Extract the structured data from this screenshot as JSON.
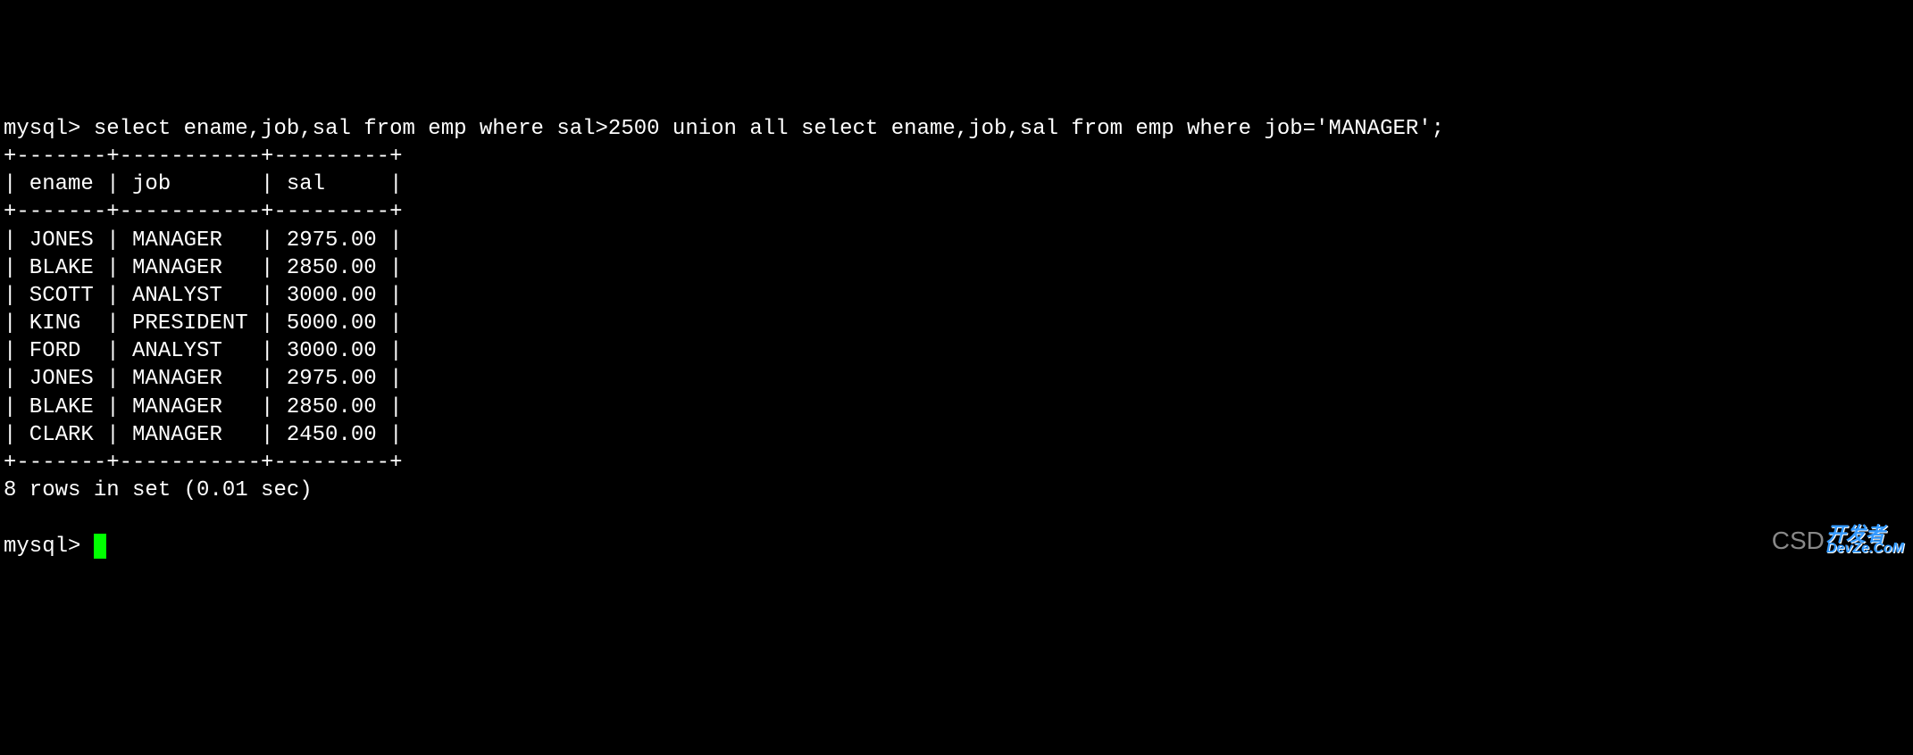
{
  "prompt1": "mysql> ",
  "query": "select ename,job,sal from emp where sal>2500 union all select ename,job,sal from emp where job='MANAGER';",
  "table_border_top": "+-------+-----------+---------+",
  "table_header": "| ename | job       | sal     |",
  "table_border_mid": "+-------+-----------+---------+",
  "rows": [
    "| JONES | MANAGER   | 2975.00 |",
    "| BLAKE | MANAGER   | 2850.00 |",
    "| SCOTT | ANALYST   | 3000.00 |",
    "| KING  | PRESIDENT | 5000.00 |",
    "| FORD  | ANALYST   | 3000.00 |",
    "| JONES | MANAGER   | 2975.00 |",
    "| BLAKE | MANAGER   | 2850.00 |",
    "| CLARK | MANAGER   | 2450.00 |"
  ],
  "table_border_bottom": "+-------+-----------+---------+",
  "result_summary": "8 rows in set (0.01 sec)",
  "empty_line": "",
  "prompt2": "mysql> ",
  "chart_data": {
    "type": "table",
    "headers": [
      "ename",
      "job",
      "sal"
    ],
    "rows": [
      [
        "JONES",
        "MANAGER",
        2975.0
      ],
      [
        "BLAKE",
        "MANAGER",
        2850.0
      ],
      [
        "SCOTT",
        "ANALYST",
        3000.0
      ],
      [
        "KING",
        "PRESIDENT",
        5000.0
      ],
      [
        "FORD",
        "ANALYST",
        3000.0
      ],
      [
        "JONES",
        "MANAGER",
        2975.0
      ],
      [
        "BLAKE",
        "MANAGER",
        2850.0
      ],
      [
        "CLARK",
        "MANAGER",
        2450.0
      ]
    ]
  },
  "watermark": {
    "csd": "CSD",
    "dev_top": "开发者",
    "dev_bottom": "DevZe.CoM"
  }
}
